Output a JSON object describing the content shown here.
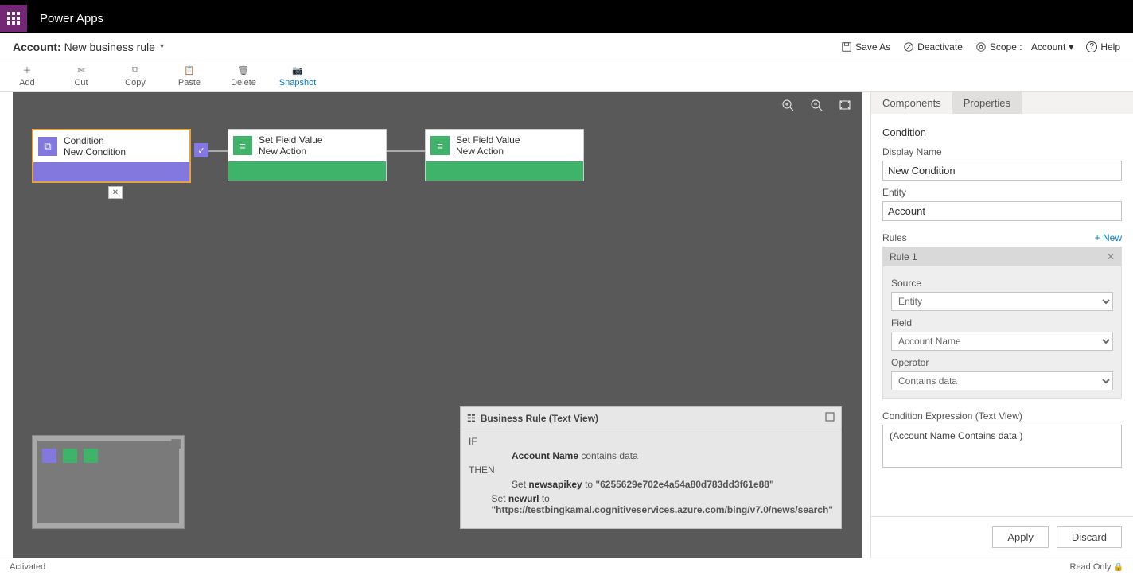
{
  "brand": "Power Apps",
  "pageTitle": {
    "pre": "Account:",
    "name": "New business rule"
  },
  "subheaderActions": {
    "saveAs": "Save As",
    "deactivate": "Deactivate",
    "scopeLabel": "Scope :",
    "scopeValue": "Account",
    "help": "Help"
  },
  "toolbar": {
    "add": "Add",
    "cut": "Cut",
    "copy": "Copy",
    "paste": "Paste",
    "del": "Delete",
    "snapshot": "Snapshot"
  },
  "nodes": {
    "cond": {
      "line1": "Condition",
      "line2": "New Condition"
    },
    "a1": {
      "line1": "Set Field Value",
      "line2": "New Action"
    },
    "a2": {
      "line1": "Set Field Value",
      "line2": "New Action"
    }
  },
  "textView": {
    "title": "Business Rule (Text View)",
    "ifLabel": "IF",
    "thenLabel": "THEN",
    "ifLine": {
      "bold": "Account Name",
      "rest": " contains data"
    },
    "then1": {
      "pre": "Set ",
      "bold": "newsapikey",
      "mid": " to ",
      "val": "\"6255629e702e4a54a80d783dd3f61e88\""
    },
    "then2": {
      "pre": "Set ",
      "bold": "newurl",
      "mid": " to ",
      "val": "\"https://testbingkamal.cognitiveservices.azure.com/bing/v7.0/news/search\""
    }
  },
  "panel": {
    "tabs": {
      "components": "Components",
      "properties": "Properties"
    },
    "header": "Condition",
    "displayNameLabel": "Display Name",
    "displayNameValue": "New Condition",
    "entityLabel": "Entity",
    "entityValue": "Account",
    "rulesLabel": "Rules",
    "newLink": "+ New",
    "ruleTitle": "Rule 1",
    "sourceLabel": "Source",
    "sourceValue": "Entity",
    "fieldLabel": "Field",
    "fieldValue": "Account Name",
    "operatorLabel": "Operator",
    "operatorValue": "Contains data",
    "exprLabel": "Condition Expression (Text View)",
    "exprValue": "(Account Name Contains data )",
    "apply": "Apply",
    "discard": "Discard"
  },
  "status": {
    "left": "Activated",
    "right": "Read Only"
  }
}
